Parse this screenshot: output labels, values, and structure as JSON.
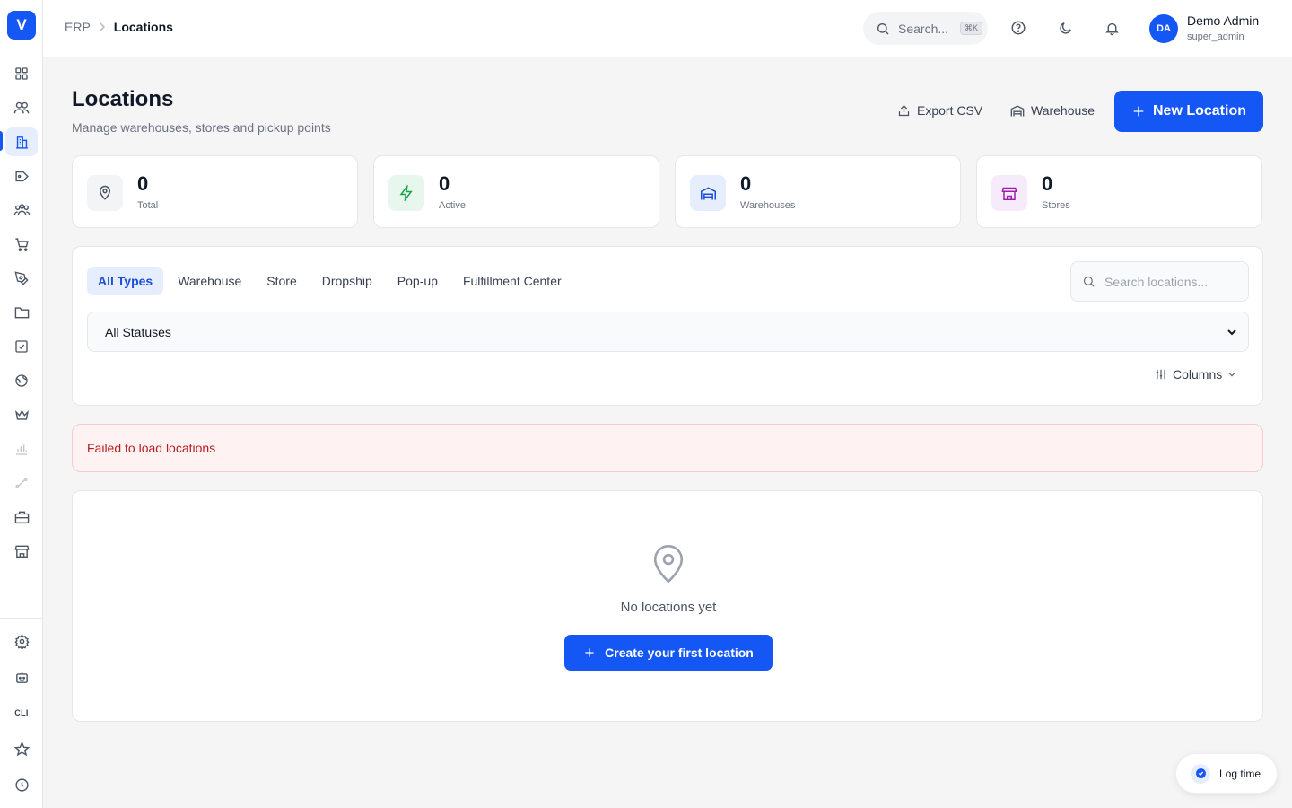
{
  "app": {
    "logo_letter": "V",
    "brand_color": "#1457f5"
  },
  "sidebar": {
    "cli_label": "CLI",
    "items": [
      {
        "icon": "dashboard-icon"
      },
      {
        "icon": "users-icon"
      },
      {
        "icon": "building-icon",
        "active": true
      },
      {
        "icon": "tag-icon"
      },
      {
        "icon": "team-icon"
      },
      {
        "icon": "cart-icon"
      },
      {
        "icon": "pen-icon"
      },
      {
        "icon": "folder-icon"
      },
      {
        "icon": "checkbox-icon"
      },
      {
        "icon": "globe-icon"
      },
      {
        "icon": "crown-icon"
      },
      {
        "icon": "bar-chart-icon"
      },
      {
        "icon": "route-icon"
      },
      {
        "icon": "briefcase-icon"
      },
      {
        "icon": "store-icon"
      }
    ],
    "bottom_items": [
      {
        "icon": "settings-icon"
      },
      {
        "icon": "robot-icon"
      },
      {
        "icon": "cli-icon"
      },
      {
        "icon": "star-icon"
      },
      {
        "icon": "clock-icon"
      }
    ]
  },
  "topbar": {
    "breadcrumb": {
      "root": "ERP",
      "current": "Locations"
    },
    "search": {
      "placeholder": "Search...",
      "shortcut": "⌘K"
    },
    "user": {
      "initials": "DA",
      "name": "Demo Admin",
      "role": "super_admin"
    }
  },
  "header": {
    "title": "Locations",
    "subtitle": "Manage warehouses, stores and pickup points",
    "export_label": "Export CSV",
    "warehouse_label": "Warehouse",
    "new_label": "New Location"
  },
  "stats": [
    {
      "value": "0",
      "label": "Total",
      "icon": "map-pin-icon",
      "bg": "#f3f4f6",
      "fg": "#4b5563"
    },
    {
      "value": "0",
      "label": "Active",
      "icon": "bolt-icon",
      "bg": "#e8f7ee",
      "fg": "#16a34a"
    },
    {
      "value": "0",
      "label": "Warehouses",
      "icon": "warehouse-icon",
      "bg": "#e6eefe",
      "fg": "#1d4ed8"
    },
    {
      "value": "0",
      "label": "Stores",
      "icon": "store-icon",
      "bg": "#f6ebfb",
      "fg": "#a21caf"
    }
  ],
  "filters": {
    "tabs": [
      "All Types",
      "Warehouse",
      "Store",
      "Dropship",
      "Pop-up",
      "Fulfillment Center"
    ],
    "active_tab": "All Types",
    "search_placeholder": "Search locations...",
    "status_selected": "All Statuses",
    "columns_label": "Columns"
  },
  "error": {
    "message": "Failed to load locations"
  },
  "empty": {
    "message": "No locations yet",
    "cta": "Create your first location"
  },
  "log_time": {
    "label": "Log time"
  }
}
